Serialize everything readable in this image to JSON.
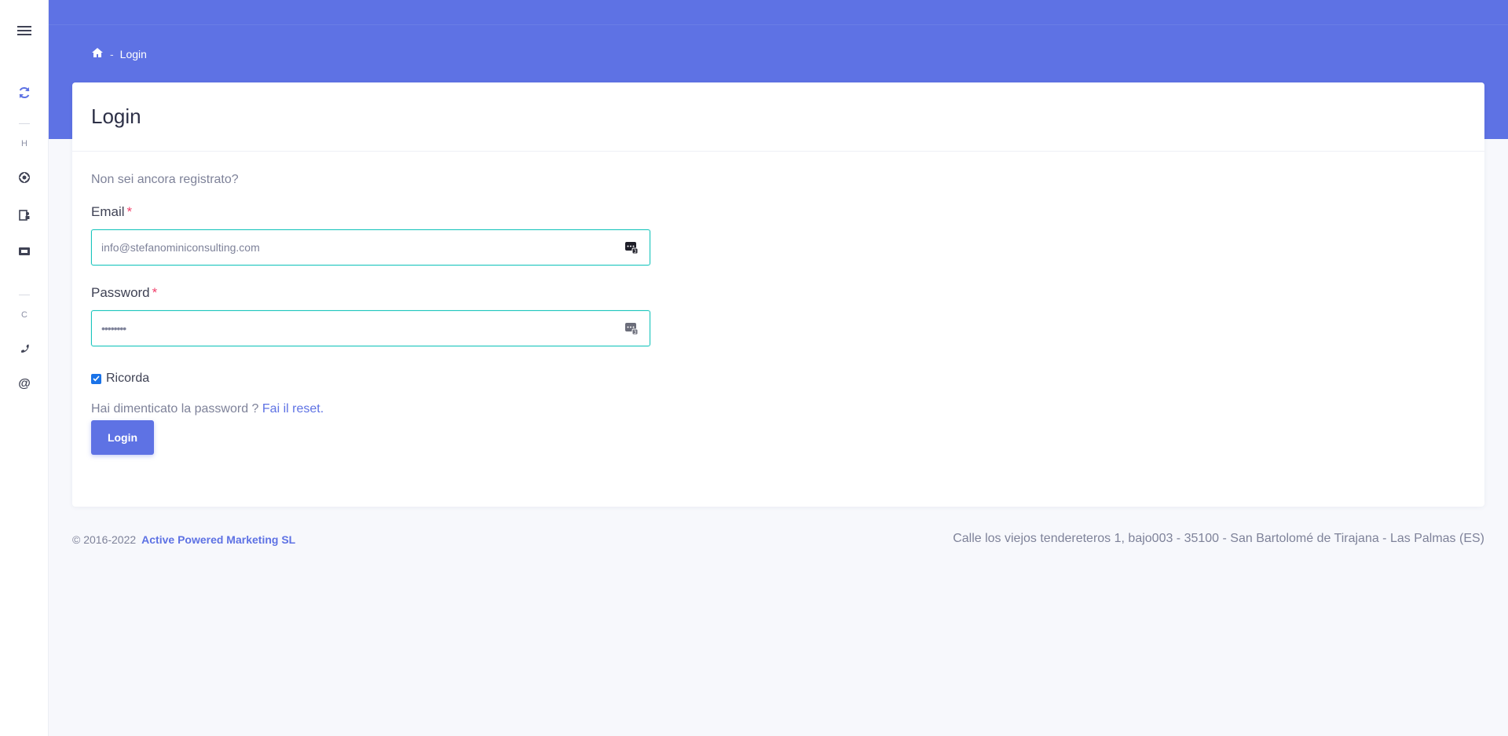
{
  "sidebar": {
    "icons": [
      "menu-icon",
      "refresh-icon",
      "lifebuoy-icon",
      "contact-card-icon",
      "ticket-icon",
      "phone-icon",
      "at-icon"
    ],
    "section_letters": [
      "H",
      "C"
    ]
  },
  "breadcrumb": {
    "home_icon": "home-icon",
    "separator": "-",
    "current": "Login"
  },
  "card": {
    "title": "Login"
  },
  "form": {
    "register_prompt": "Non sei ancora registrato?",
    "email_label": "Email",
    "email_value": "info@stefanominiconsulting.com",
    "password_label": "Password",
    "password_value": "••••••••",
    "required_mark": "*",
    "remember_label": "Ricorda",
    "remember_checked": true,
    "forgot_text": "Hai dimenticato la password ?",
    "reset_link": "Fai il reset.",
    "login_button": "Login"
  },
  "footer": {
    "copyright": "© 2016-2022",
    "company": "Active Powered Marketing SL",
    "address": "Calle los viejos tendereteros 1, bajo003 - 35100 - San Bartolomé de Tirajana - Las Palmas (ES)"
  },
  "colors": {
    "accent": "#5e72e4",
    "input_border": "#1bc5bd",
    "required": "#f1416c",
    "background": "#f7f8fc"
  }
}
